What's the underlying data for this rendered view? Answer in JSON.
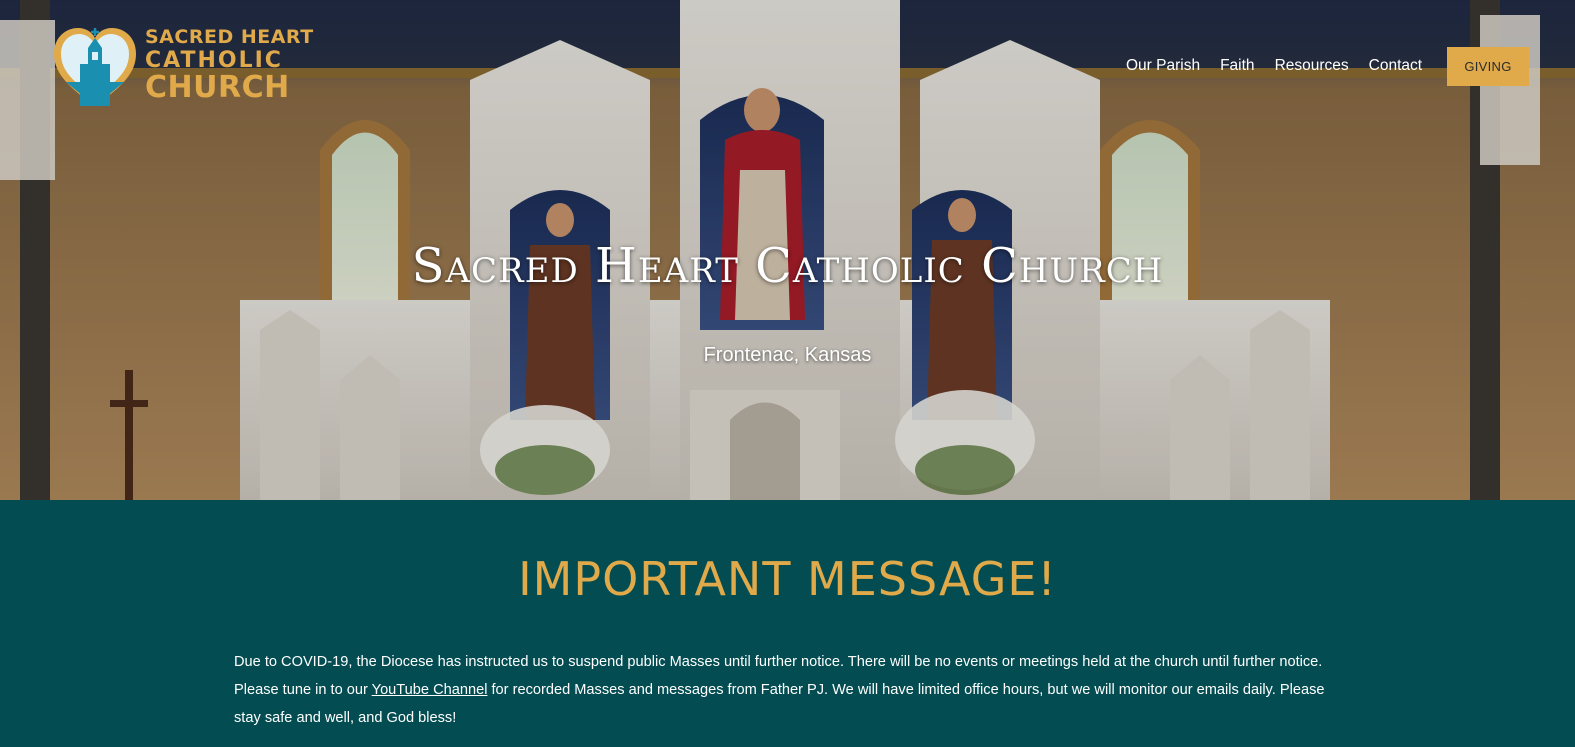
{
  "logo": {
    "line1": "SACRED HEART",
    "line2": "CATHOLIC",
    "line3": "CHURCH"
  },
  "nav": {
    "items": [
      {
        "label": "Our Parish"
      },
      {
        "label": "Faith"
      },
      {
        "label": "Resources"
      },
      {
        "label": "Contact"
      }
    ],
    "giving_label": "GIVING"
  },
  "hero": {
    "title": "Sacred Heart Catholic Church",
    "subtitle": "Frontenac, Kansas"
  },
  "message": {
    "heading": "IMPORTANT MESSAGE!",
    "body_part1": "Due to COVID-19, the Diocese has instructed us to suspend public Masses until further notice.  There will be no events or meetings held at the church until further notice.  Please tune in to our ",
    "link_text": "YouTube Channel",
    "body_part2": " for recorded Masses and messages from Father PJ.  We will have limited office hours, but we will monitor our emails daily.  Please stay safe and well, and God bless!"
  },
  "colors": {
    "gold": "#e0a94a",
    "teal": "#034d52",
    "logo_blue": "#1a8fb0"
  }
}
